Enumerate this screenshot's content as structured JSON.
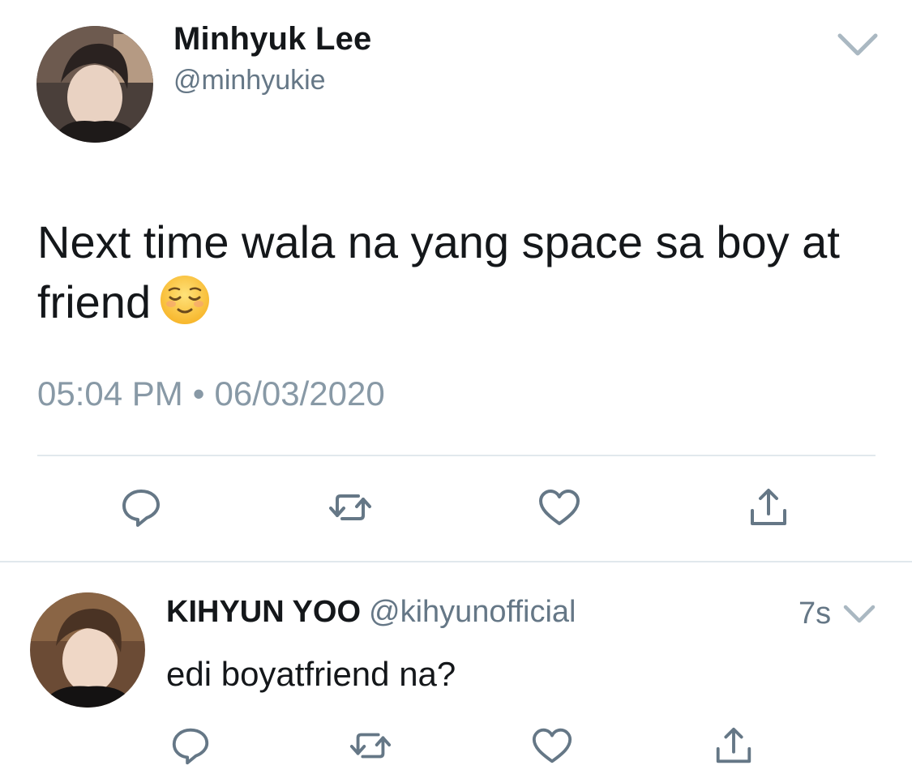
{
  "main_tweet": {
    "author_name": "Minhyuk Lee",
    "author_handle": "@minhyukie",
    "text": "Next time wala na yang space sa boy at friend",
    "emoji": "relieved-face-emoji",
    "time": "05:04 PM",
    "separator": "•",
    "date": "06/03/2020",
    "actions": {
      "reply_icon": "reply-icon",
      "retweet_icon": "retweet-icon",
      "like_icon": "heart-icon",
      "share_icon": "share-icon"
    }
  },
  "reply_tweet": {
    "author_name": "KIHYUN YOO",
    "author_handle": "@kihyunofficial",
    "relative_time": "7s",
    "text": "edi boyatfriend na?",
    "actions": {
      "reply_icon": "reply-icon",
      "retweet_icon": "retweet-icon",
      "like_icon": "heart-icon",
      "share_icon": "share-icon"
    }
  },
  "colors": {
    "text_primary": "#14171a",
    "text_secondary": "#657786",
    "icon": "#657786",
    "divider": "#e1e8ed",
    "background": "#ffffff"
  }
}
